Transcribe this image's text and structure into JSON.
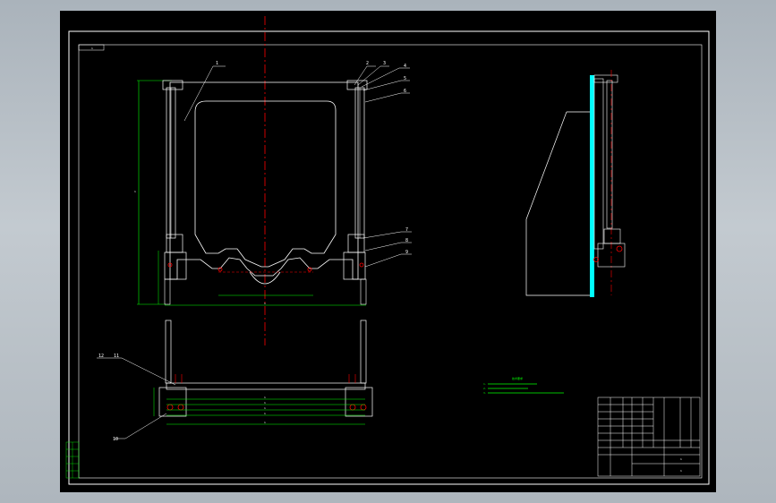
{
  "colors": {
    "background": "#000000",
    "frame": "#ffffff",
    "geometry": "#ffffff",
    "dimension": "#00ff00",
    "centerline": "#ff0000",
    "glass": "#00ffff",
    "joint": "#ff0000",
    "note_text": "#00ff00"
  },
  "front_view": {
    "balloons": [
      "1",
      "2",
      "3",
      "4",
      "5",
      "6",
      "7",
      "8",
      "9"
    ],
    "height_dim": "1",
    "width_dim": "1"
  },
  "top_view": {
    "balloons": [
      "10",
      "11",
      "12"
    ],
    "dims": [
      "1",
      "1",
      "1",
      "1",
      "1"
    ]
  },
  "notes": {
    "title": "技术要求",
    "lines": [
      "1.",
      "2.",
      "3."
    ]
  },
  "title_block": {
    "name_cell": "1",
    "sheet": "1"
  },
  "corner_label": "1"
}
